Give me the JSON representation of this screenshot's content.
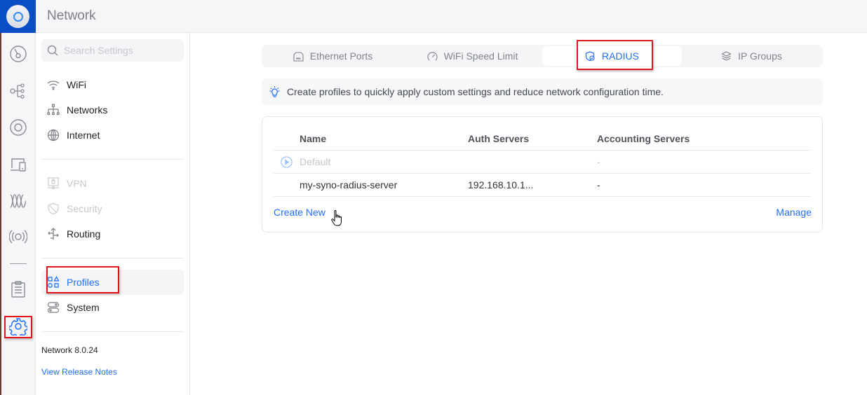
{
  "app": {
    "title": "Network"
  },
  "rail": {
    "items": [
      {
        "icon": "dashboard-icon",
        "label": "Dashboard"
      },
      {
        "icon": "topology-icon",
        "label": "Topology"
      },
      {
        "icon": "devices-icon",
        "label": "UniFi Devices"
      },
      {
        "icon": "client-devices-icon",
        "label": "Client Devices"
      },
      {
        "icon": "insights-icon",
        "label": "Insights"
      },
      {
        "icon": "radio-icon",
        "label": "Radios"
      },
      {
        "icon": "logs-icon",
        "label": "Logs"
      },
      {
        "icon": "settings-icon",
        "label": "Settings",
        "active": true
      }
    ]
  },
  "sidebar": {
    "search_placeholder": "Search Settings",
    "groups": [
      [
        {
          "icon": "wifi-icon",
          "label": "WiFi"
        },
        {
          "icon": "networks-icon",
          "label": "Networks"
        },
        {
          "icon": "internet-icon",
          "label": "Internet"
        }
      ],
      [
        {
          "icon": "vpn-icon",
          "label": "VPN",
          "disabled": true
        },
        {
          "icon": "security-icon",
          "label": "Security",
          "disabled": true
        },
        {
          "icon": "routing-icon",
          "label": "Routing"
        }
      ],
      [
        {
          "icon": "profiles-icon",
          "label": "Profiles",
          "active": true
        },
        {
          "icon": "system-icon",
          "label": "System"
        }
      ]
    ],
    "version": "Network 8.0.24",
    "release_notes": "View Release Notes"
  },
  "tabs": [
    {
      "icon": "ethernet-port-icon",
      "label": "Ethernet Ports"
    },
    {
      "icon": "speedometer-icon",
      "label": "WiFi Speed Limit"
    },
    {
      "icon": "shield-check-icon",
      "label": "RADIUS",
      "active": true
    },
    {
      "icon": "layers-icon",
      "label": "IP Groups"
    }
  ],
  "hint": {
    "text": "Create profiles to quickly apply custom settings and reduce network configuration time."
  },
  "radius_table": {
    "columns": [
      "Name",
      "Auth Servers",
      "Accounting Servers"
    ],
    "rows": [
      {
        "name": "Default",
        "auth": "",
        "acct": "-",
        "is_default": true
      },
      {
        "name": "my-syno-radius-server",
        "auth": "192.168.10.1...",
        "acct": "-"
      }
    ],
    "create_new": "Create New",
    "manage": "Manage"
  },
  "colors": {
    "accent": "#1f6fff",
    "highlight": "#e0141b",
    "logo_bg": "#0a4ec7"
  }
}
